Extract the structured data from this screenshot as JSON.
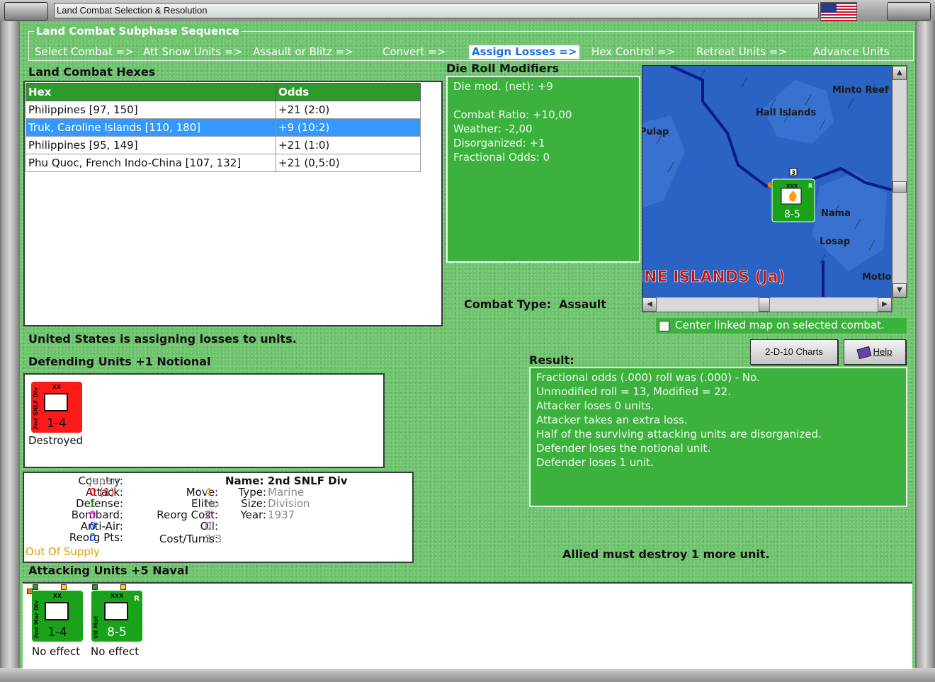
{
  "window": {
    "title": "Land Combat Selection & Resolution"
  },
  "sequence": {
    "title": "Land Combat Subphase Sequence",
    "steps": [
      "Select Combat =>",
      "Att Snow Units =>",
      "Assault or Blitz =>",
      "Convert =>",
      "Assign Losses =>",
      "Hex Control =>",
      "Retreat Units =>",
      "Advance Units"
    ],
    "active_index": 4
  },
  "hexes": {
    "title": "Land Combat Hexes",
    "col_hex": "Hex",
    "col_odds": "Odds",
    "rows": [
      {
        "hex": "Philippines [97, 150]",
        "odds": "+21 (2:0)"
      },
      {
        "hex": "Truk, Caroline Islands [110, 180]",
        "odds": "+9 (10:2)"
      },
      {
        "hex": "Philippines [95, 149]",
        "odds": "+21 (1:0)"
      },
      {
        "hex": "Phu Quoc, French Indo-China [107, 132]",
        "odds": "+21 (0,5:0)"
      }
    ],
    "selected_index": 1
  },
  "die_roll": {
    "title": "Die Roll Modifiers",
    "lines": [
      "Die mod. (net): +9",
      "",
      "Combat Ratio: +10,00",
      "Weather: -2,00",
      "Disorganized: +1",
      "Fractional Odds: 0"
    ]
  },
  "map": {
    "labels": [
      "Minto Reef",
      "Hall Islands",
      "Pulap",
      "Nama",
      "Losap",
      "Motlo",
      "INE ISLANDS (Ja)"
    ],
    "unit": {
      "strength": "8-5",
      "size": "XXX",
      "name": "VII Mot",
      "corner": "R",
      "stack": "3"
    }
  },
  "combat_type": {
    "label": "Combat Type:",
    "value": "Assault"
  },
  "center_linked": {
    "label": "Center linked map on selected combat.",
    "checked": false
  },
  "buttons": {
    "charts": "2-D-10 Charts",
    "help": "Help"
  },
  "status": "United States is assigning losses to units.",
  "result": {
    "title": "Result:",
    "lines": [
      "Fractional odds (.000) roll was (.000)  - No.",
      "Unmodified roll = 13, Modified = 22.",
      "Attacker loses 0 units.",
      "Attacker takes an extra loss.",
      "Half of the surviving attacking units are disorganized.",
      "Defender loses the notional unit.",
      "Defender loses 1 unit."
    ]
  },
  "allied_msg": "Allied must destroy 1 more unit.",
  "defending": {
    "title": "Defending Units +1 Notional",
    "units": [
      {
        "name": "2nd SNLF Div",
        "size": "XX",
        "strength": "1-4",
        "status": "Destroyed",
        "color": "#ff1a1a"
      }
    ]
  },
  "unit_info": {
    "country_label": "Country:",
    "country": "Japan",
    "attack_label": "Attack:",
    "attack": "0 (1)",
    "defense_label": "Defense:",
    "defense": "1",
    "bombard_label": "Bombard:",
    "bombard": "0",
    "antiair_label": "Anti-Air:",
    "antiair": "0",
    "reorgpts_label": "Reorg Pts:",
    "reorgpts": "0",
    "supply": "Out Of Supply",
    "move_label": "Move:",
    "move": "4",
    "elite_label": "Elite:",
    "elite": "No",
    "reorgcost_label": "Reorg Cost:",
    "reorgcost": "2",
    "oil_label": "Oil:",
    "oil": "0",
    "costturns_label": "Cost/Turns:",
    "costturns": "3/3",
    "name_label": "Name:",
    "name": "2nd SNLF Div",
    "type_label": "Type:",
    "type": "Marine",
    "size_label": "Size:",
    "size": "Division",
    "year_label": "Year:",
    "year": "1937",
    "colors": {
      "attack": "#ff0000",
      "defense": "#22aa22",
      "bombard": "#cc00cc",
      "antiair": "#0033cc",
      "reorgpts": "#0033cc",
      "supply": "#e0a000",
      "move": "#e0a000",
      "reorgcost": "#cc00cc"
    }
  },
  "attacking": {
    "title": "Attacking Units +5 Naval",
    "units": [
      {
        "name": "2nd Mar Div",
        "size": "XX",
        "strength": "1-4",
        "status": "No effect",
        "color": "#1aa31a"
      },
      {
        "name": "VII Mot",
        "size": "XXX",
        "strength": "8-5",
        "status": "No effect",
        "color": "#1aa31a",
        "corner": "R"
      }
    ]
  }
}
